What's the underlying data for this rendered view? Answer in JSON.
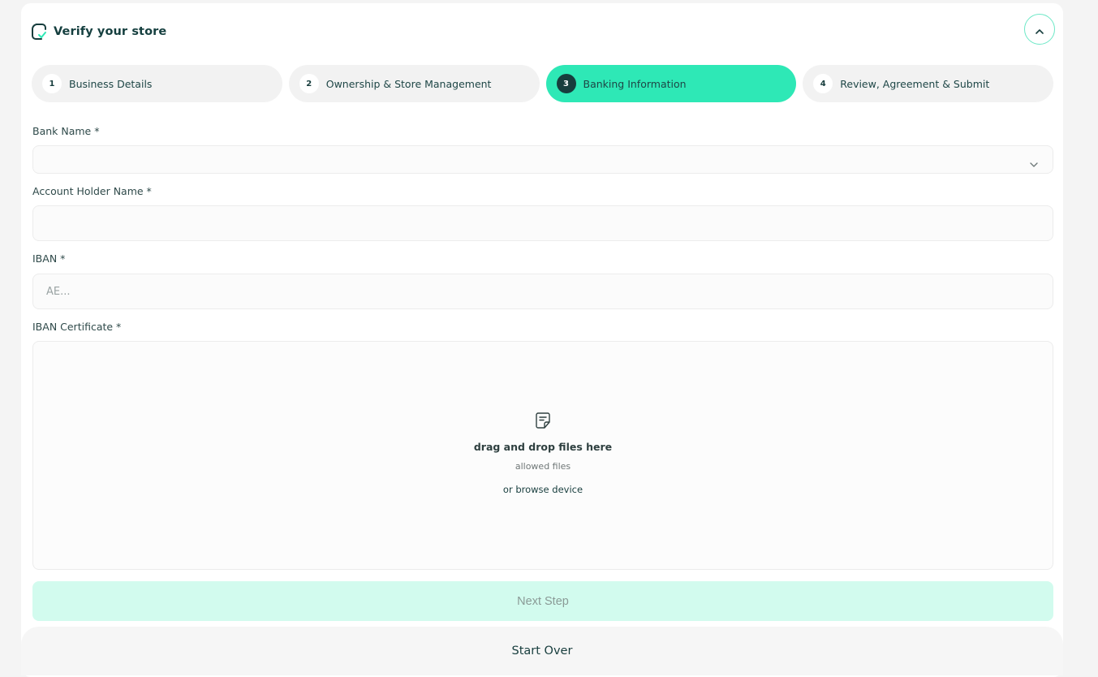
{
  "header": {
    "title": "Verify your store",
    "logo_icon": "store-check-icon",
    "collapse_icon": "chevron-up-icon"
  },
  "steps": [
    {
      "number": "1",
      "label": "Business Details",
      "active": false
    },
    {
      "number": "2",
      "label": "Ownership & Store Management",
      "active": false
    },
    {
      "number": "3",
      "label": "Banking Information",
      "active": true
    },
    {
      "number": "4",
      "label": "Review, Agreement & Submit",
      "active": false
    }
  ],
  "form": {
    "bank_name": {
      "label": "Bank Name *",
      "value": "",
      "icon": "chevron-down-icon"
    },
    "account_holder": {
      "label": "Account Holder Name *",
      "value": "",
      "placeholder": ""
    },
    "iban": {
      "label": "IBAN *",
      "value": "",
      "placeholder": "AE..."
    },
    "iban_certificate": {
      "label": "IBAN Certificate *",
      "icon": "file-icon",
      "title": "drag and drop files here",
      "allowed": "allowed files",
      "browse": "or browse device"
    }
  },
  "actions": {
    "next_label": "Next Step",
    "start_over_label": "Start Over"
  },
  "colors": {
    "accent": "#2ee8b6",
    "accent_light": "#d2fbee",
    "primary_text": "#173d3d"
  }
}
